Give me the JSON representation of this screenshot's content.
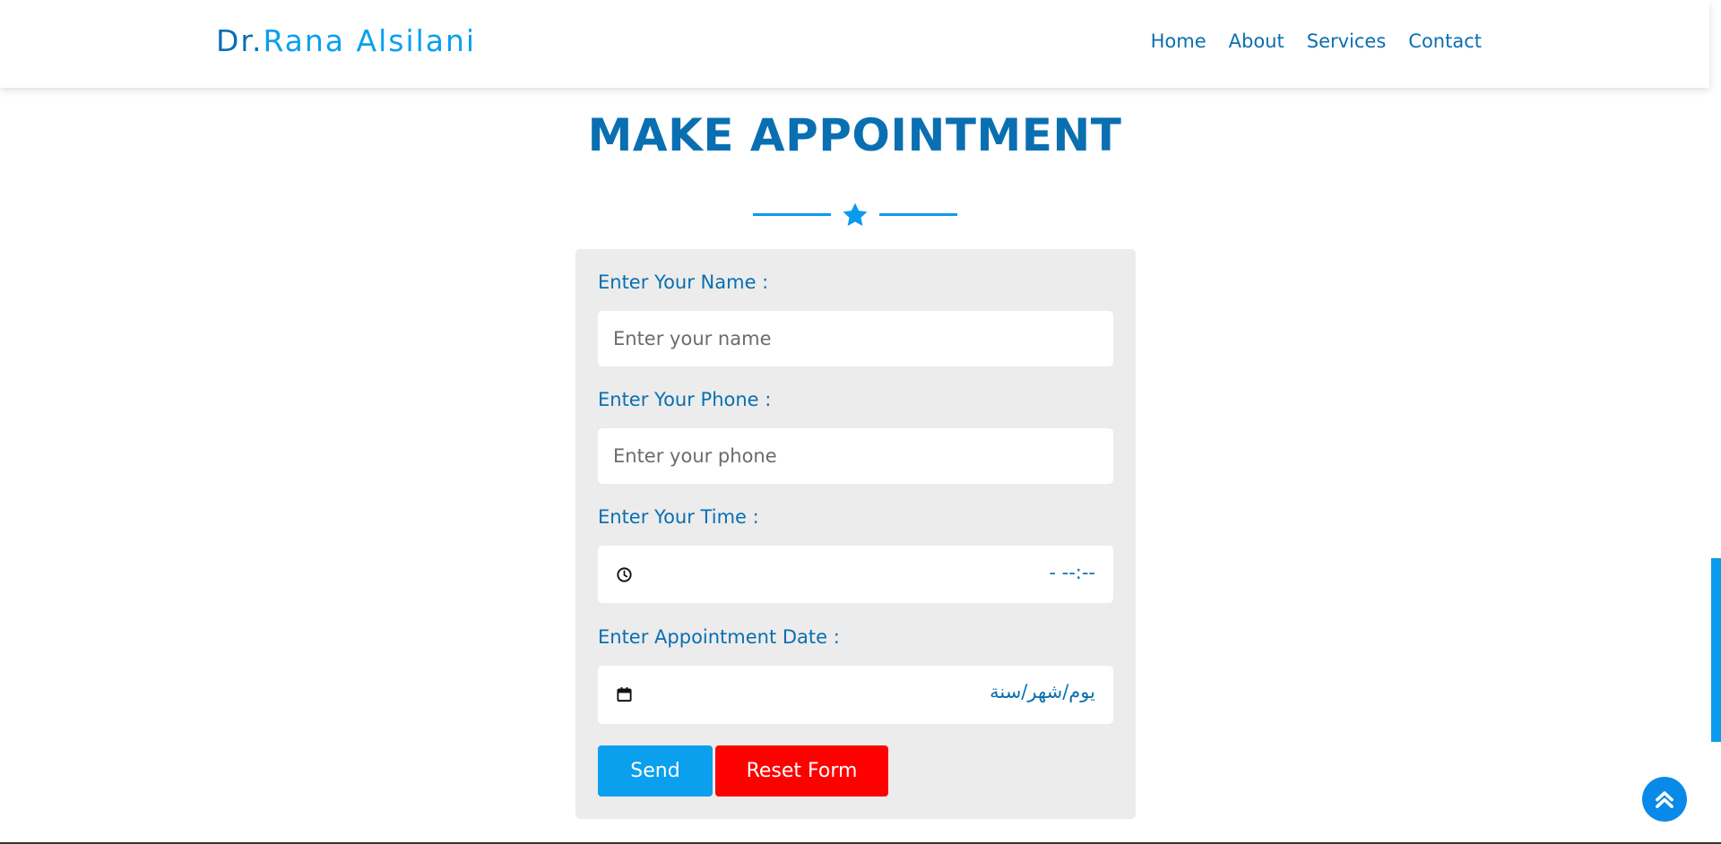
{
  "header": {
    "brand_prefix": "Dr.",
    "brand_name": "Rana Alsilani",
    "nav": [
      "Home",
      "About",
      "Services",
      "Contact"
    ]
  },
  "page": {
    "title": "MAKE APPOINTMENT"
  },
  "form": {
    "name_label": "Enter Your Name :",
    "name_placeholder": "Enter your name",
    "phone_label": "Enter Your Phone :",
    "phone_placeholder": "Enter your phone",
    "time_label": "Enter Your Time :",
    "time_value": "- --:--",
    "time_icon": "clock-icon",
    "date_label": "Enter Appointment Date :",
    "date_value": "يوم/شهر/سنة",
    "date_icon": "calendar-icon",
    "send_label": "Send",
    "reset_label": "Reset Form"
  },
  "colors": {
    "primary": "#0a6fb1",
    "accent": "#0aa0ee",
    "danger": "#ff0000",
    "card_bg": "#ececec"
  },
  "icons": {
    "divider": "star-icon",
    "scroll_top": "double-chevron-up-icon"
  }
}
